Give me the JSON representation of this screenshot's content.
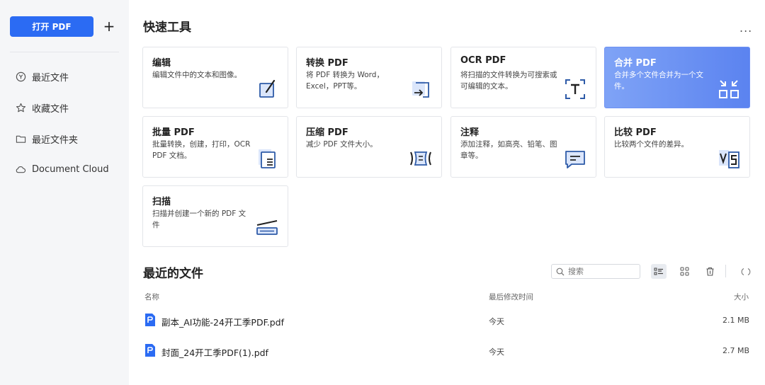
{
  "sidebar": {
    "open_button": "打开 PDF",
    "add_button": "+",
    "items": [
      {
        "label": "最近文件",
        "icon": "recent-clock-icon"
      },
      {
        "label": "收藏文件",
        "icon": "star-icon"
      },
      {
        "label": "最近文件夹",
        "icon": "folder-icon"
      },
      {
        "label": "Document Cloud",
        "icon": "cloud-icon"
      }
    ]
  },
  "quick_tools": {
    "title": "快速工具",
    "more": "...",
    "cards": [
      {
        "title": "编辑",
        "desc": "编辑文件中的文本和图像。",
        "icon": "edit-icon"
      },
      {
        "title": "转换 PDF",
        "desc": "将 PDF 转换为 Word，Excel，PPT等。",
        "icon": "convert-icon"
      },
      {
        "title": "OCR PDF",
        "desc": "将扫描的文件转换为可搜索或可编辑的文本。",
        "icon": "ocr-icon"
      },
      {
        "title": "合并 PDF",
        "desc": "合并多个文件合并为一个文件。",
        "icon": "merge-icon"
      },
      {
        "title": "批量 PDF",
        "desc": "批量转换，创建，打印，OCR PDF 文档。",
        "icon": "batch-icon"
      },
      {
        "title": "压缩 PDF",
        "desc": "减少 PDF 文件大小。",
        "icon": "compress-icon"
      },
      {
        "title": "注释",
        "desc": "添加注释，如高亮、铅笔、图章等。",
        "icon": "comment-icon"
      },
      {
        "title": "比较 PDF",
        "desc": "比较两个文件的差异。",
        "icon": "compare-icon"
      },
      {
        "title": "扫描",
        "desc": "扫描并创建一个新的 PDF 文件",
        "icon": "scan-icon"
      }
    ]
  },
  "recent_files": {
    "title": "最近的文件",
    "search_placeholder": "搜索",
    "columns": {
      "name": "名称",
      "modified": "最后修改时间",
      "size": "大小"
    },
    "rows": [
      {
        "name": "副本_AI功能-24开工季PDF.pdf",
        "modified": "今天",
        "size": "2.1 MB"
      },
      {
        "name": "封面_24开工季PDF(1).pdf",
        "modified": "今天",
        "size": "2.7 MB"
      }
    ]
  },
  "colors": {
    "accent": "#2b6bf3",
    "active_card": "#6d91f3",
    "sidebar_bg": "#f5f6f8"
  }
}
